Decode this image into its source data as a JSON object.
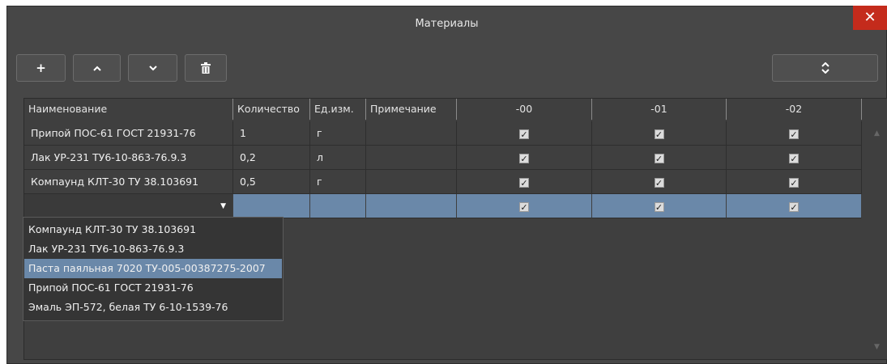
{
  "window": {
    "title": "Материалы",
    "close_icon": "✕"
  },
  "toolbar": {
    "add_icon": "+",
    "up_icon": "^",
    "down_icon": "v",
    "delete_icon": "trash",
    "swap_icon": "⇅"
  },
  "table": {
    "headers": [
      "Наименование",
      "Количество",
      "Ед.изм.",
      "Примечание",
      "-00",
      "-01",
      "-02"
    ],
    "rows": [
      {
        "name": "Припой ПОС-61 ГОСТ 21931-76",
        "qty": "1",
        "unit": "г",
        "note": "",
        "c00": true,
        "c01": true,
        "c02": true
      },
      {
        "name": "Лак УР-231 ТУ6-10-863-76.9.3",
        "qty": "0,2",
        "unit": "л",
        "note": "",
        "c00": true,
        "c01": true,
        "c02": true
      },
      {
        "name": "Компаунд КЛТ-30 ТУ 38.103691",
        "qty": "0,5",
        "unit": "г",
        "note": "",
        "c00": true,
        "c01": true,
        "c02": true
      },
      {
        "name": "",
        "qty": "",
        "unit": "",
        "note": "",
        "c00": true,
        "c01": true,
        "c02": true
      }
    ]
  },
  "dropdown": {
    "items": [
      "Компаунд КЛТ-30 ТУ 38.103691",
      "Лак УР-231 ТУ6-10-863-76.9.3",
      "Паста паяльная 7020 ТУ-005-00387275-2007",
      "Припой ПОС-61 ГОСТ 21931-76",
      "Эмаль ЭП-572, белая ТУ 6-10-1539-76"
    ],
    "highlighted_index": 2
  },
  "colors": {
    "background": "#474747",
    "selection": "#6a88a9",
    "close": "#c42b1c"
  }
}
